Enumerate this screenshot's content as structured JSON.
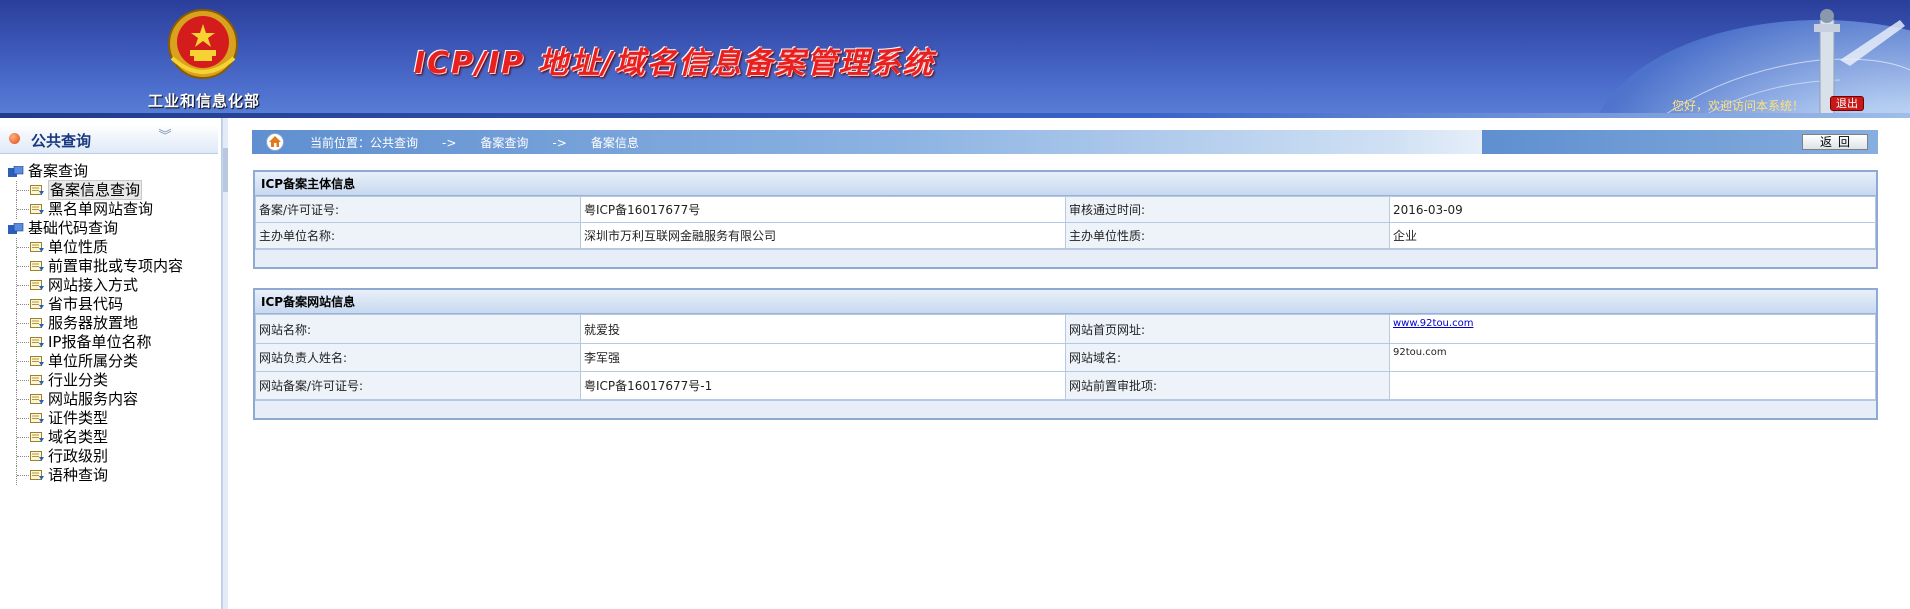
{
  "header": {
    "ministry_name": "工业和信息化部",
    "system_title": "ICP/IP 地址/域名信息备案管理系统",
    "welcome": "您好，欢迎访问本系统！",
    "logout_label": "退出"
  },
  "sidebar": {
    "title": "公共查询",
    "groups": [
      {
        "label": "备案查询",
        "items": [
          {
            "label": "备案信息查询",
            "active": true
          },
          {
            "label": "黑名单网站查询"
          }
        ]
      },
      {
        "label": "基础代码查询",
        "items": [
          {
            "label": "单位性质"
          },
          {
            "label": "前置审批或专项内容"
          },
          {
            "label": "网站接入方式"
          },
          {
            "label": "省市县代码"
          },
          {
            "label": "服务器放置地"
          },
          {
            "label": "IP报备单位名称"
          },
          {
            "label": "单位所属分类"
          },
          {
            "label": "行业分类"
          },
          {
            "label": "网站服务内容"
          },
          {
            "label": "证件类型"
          },
          {
            "label": "域名类型"
          },
          {
            "label": "行政级别"
          },
          {
            "label": "语种查询"
          }
        ]
      }
    ]
  },
  "breadcrumb": {
    "location": "当前位置：公共查询",
    "sep": "->",
    "level2": "备案查询",
    "level3": "备案信息"
  },
  "back_label": "返回",
  "entity_panel": {
    "title": "ICP备案主体信息",
    "rows": [
      {
        "l1": "备案/许可证号:",
        "v1": "粤ICP备16017677号",
        "l2": "审核通过时间:",
        "v2": "2016-03-09"
      },
      {
        "l1": "主办单位名称:",
        "v1": "深圳市万利互联网金融服务有限公司",
        "l2": "主办单位性质:",
        "v2": "企业"
      }
    ]
  },
  "site_panel": {
    "title": "ICP备案网站信息",
    "rows": [
      {
        "l1": "网站名称:",
        "v1": "就爱投",
        "l2": "网站首页网址:",
        "v2": "www.92tou.com"
      },
      {
        "l1": "网站负责人姓名:",
        "v1": "李军强",
        "l2": "网站域名:",
        "v2": "92tou.com"
      },
      {
        "l1": "网站备案/许可证号:",
        "v1": "粤ICP备16017677号-1",
        "l2": "网站前置审批项:",
        "v2": ""
      }
    ]
  },
  "colors": {
    "header_blue": "#3a54b4",
    "title_red": "#e82020",
    "panel_border": "#8eaad2"
  }
}
